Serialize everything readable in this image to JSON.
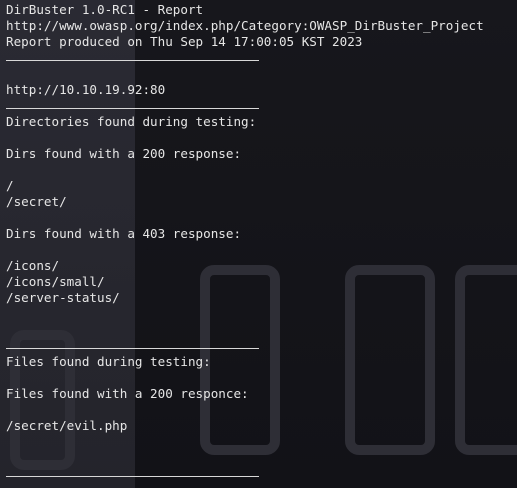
{
  "report": {
    "title": "DirBuster 1.0-RC1 - Report",
    "url": "http://www.owasp.org/index.php/Category:OWASP_DirBuster_Project",
    "produced": "Report produced on Thu Sep 14 17:00:05 KST 2023",
    "target": "http://10.10.19.92:80",
    "dirs_heading": "Directories found during testing:",
    "dirs_200_heading": "Dirs found with a 200 response:",
    "dirs_200": [
      "/",
      "/secret/"
    ],
    "dirs_403_heading": "Dirs found with a 403 response:",
    "dirs_403": [
      "/icons/",
      "/icons/small/",
      "/server-status/"
    ],
    "files_heading": "Files found during testing:",
    "files_200_heading": "Files found with a 200 responce:",
    "files_200": [
      "/secret/evil.php"
    ]
  },
  "colors": {
    "text": "#e6e6e6",
    "background": "#1c1c22"
  }
}
